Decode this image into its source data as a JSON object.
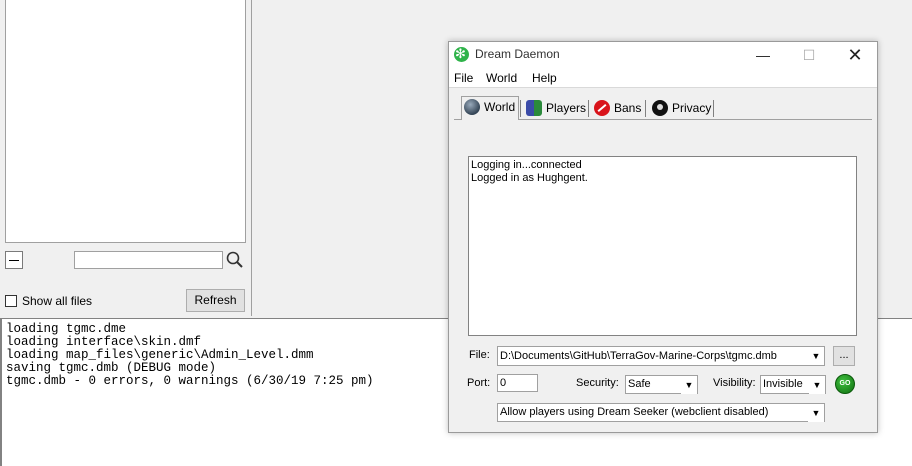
{
  "left_panel": {
    "search": {
      "value": "",
      "placeholder": ""
    },
    "show_all_files_label": "Show all files",
    "show_all_files_checked": false,
    "refresh_label": "Refresh"
  },
  "console": {
    "lines": [
      "loading tgmc.dme",
      "loading interface\\skin.dmf",
      "loading map_files\\generic\\Admin_Level.dmm",
      "saving tgmc.dmb (DEBUG mode)",
      "tgmc.dmb - 0 errors, 0 warnings (6/30/19 7:25 pm)"
    ]
  },
  "daemon": {
    "title": "Dream Daemon",
    "window_controls": {
      "minimize": "—",
      "maximize": "☐",
      "close": "✕"
    },
    "menu": {
      "file": "File",
      "world": "World",
      "help": "Help"
    },
    "tabs": {
      "world": {
        "label": "World",
        "icon": "globe-icon"
      },
      "players": {
        "label": "Players",
        "icon": "players-icon"
      },
      "bans": {
        "label": "Bans",
        "icon": "ban-icon"
      },
      "privacy": {
        "label": "Privacy",
        "icon": "privacy-icon"
      },
      "active": "World"
    },
    "log": {
      "line1": "Logging in...connected",
      "line2": "Logged in as Hughgent."
    },
    "file": {
      "label": "File:",
      "value": "D:\\Documents\\GitHub\\TerraGov-Marine-Corps\\tgmc.dmb",
      "browse_label": "..."
    },
    "port": {
      "label": "Port:",
      "value": "0"
    },
    "security": {
      "label": "Security:",
      "value": "Safe"
    },
    "visibility": {
      "label": "Visibility:",
      "value": "Invisible"
    },
    "go_label": "GO",
    "access": {
      "value": "Allow players using Dream Seeker (webclient disabled)"
    },
    "dropdown_arrow": "▼"
  }
}
